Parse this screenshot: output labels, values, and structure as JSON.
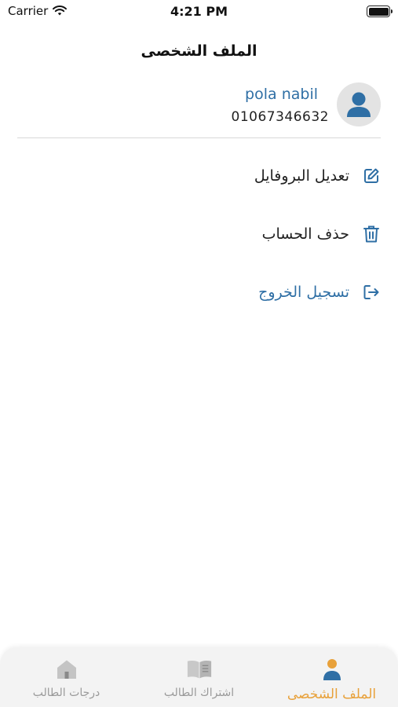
{
  "status_bar": {
    "carrier": "Carrier",
    "time": "4:21 PM"
  },
  "header": {
    "title": "الملف الشخصى"
  },
  "profile": {
    "name": "pola nabil",
    "phone": "01067346632"
  },
  "menu": {
    "items": [
      {
        "label": "تعديل البروفايل",
        "icon": "edit-icon"
      },
      {
        "label": "حذف الحساب",
        "icon": "trash-icon"
      },
      {
        "label": "تسجيل الخروج",
        "icon": "logout-icon"
      }
    ]
  },
  "tab_bar": {
    "tabs": [
      {
        "label": "الملف الشخصى",
        "icon": "person-icon",
        "active": true
      },
      {
        "label": "اشتراك الطالب",
        "icon": "book-icon",
        "active": false
      },
      {
        "label": "درجات الطالب",
        "icon": "home-icon",
        "active": false
      }
    ]
  },
  "colors": {
    "accent_blue": "#2f6fa5",
    "active_tab": "#e8a13a",
    "inactive_tab": "#9a9a9a"
  }
}
